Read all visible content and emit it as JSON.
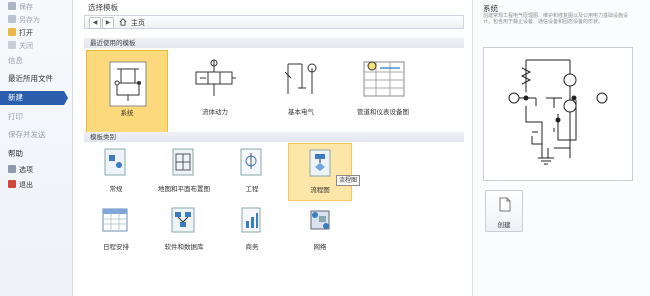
{
  "nav": {
    "items": [
      {
        "label": "保存",
        "dim": true
      },
      {
        "label": "另存为",
        "dim": true
      },
      {
        "label": "打开",
        "dim": false
      },
      {
        "label": "关闭",
        "dim": true
      },
      {
        "label": "信息",
        "dim": true
      },
      {
        "label": "最近所用文件",
        "dim": false
      },
      {
        "label": "新建",
        "dim": false,
        "selected": true
      },
      {
        "label": "打印",
        "dim": true
      },
      {
        "label": "保存并发送",
        "dim": true
      },
      {
        "label": "帮助",
        "dim": false
      },
      {
        "label": "选项",
        "dim": false
      },
      {
        "label": "退出",
        "dim": false
      }
    ]
  },
  "main": {
    "title": "选择模板",
    "breadcrumb": {
      "back": "◀",
      "forward": "▶",
      "home": "主页"
    },
    "recent_header": "最近使用的模板",
    "recent": [
      {
        "label": "系统",
        "selected": true
      },
      {
        "label": "流体动力"
      },
      {
        "label": "基本电气"
      },
      {
        "label": "管道和仪表设备图"
      }
    ],
    "categories_header": "模板类别",
    "categories": [
      {
        "label": "常规"
      },
      {
        "label": "地图和平面布置图"
      },
      {
        "label": "工程"
      },
      {
        "label": "流程图",
        "hover": true
      },
      {
        "label": "日程安排"
      },
      {
        "label": "软件和数据库"
      },
      {
        "label": "商务"
      },
      {
        "label": "网络"
      }
    ],
    "tooltip": "流程图"
  },
  "preview": {
    "title": "系统",
    "description": "创建常规工程电气原理图、维护和修复图以及公用电力基础设施设计，包含用于静止设备、通信设备和固态设备的形状。",
    "create_label": "创建"
  },
  "colors": {
    "accent": "#2a5dab",
    "selected_tile": "#fcd97a",
    "hover_tile": "#fde7a8"
  }
}
